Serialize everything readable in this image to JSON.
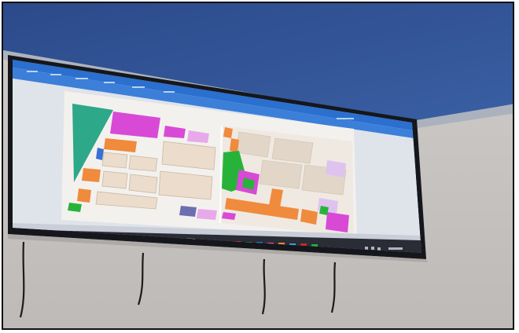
{
  "scene": {
    "description_free": true,
    "colors": {
      "ceiling": "#2f4e8c",
      "wall": "#c9c6c3",
      "bezel": "#15171c",
      "ribbon": "#2b6fcf",
      "doc": "#f3f1ee",
      "magenta": "#d84ad6",
      "orange": "#f08a3c",
      "green": "#27b33a",
      "teal": "#2da888",
      "lavender": "#dfc3ef",
      "taskbar": "#2a2d35"
    }
  },
  "taskbar": {
    "search_placeholder": ""
  },
  "icons": [
    "start-icon",
    "search-icon",
    "app-icon"
  ]
}
